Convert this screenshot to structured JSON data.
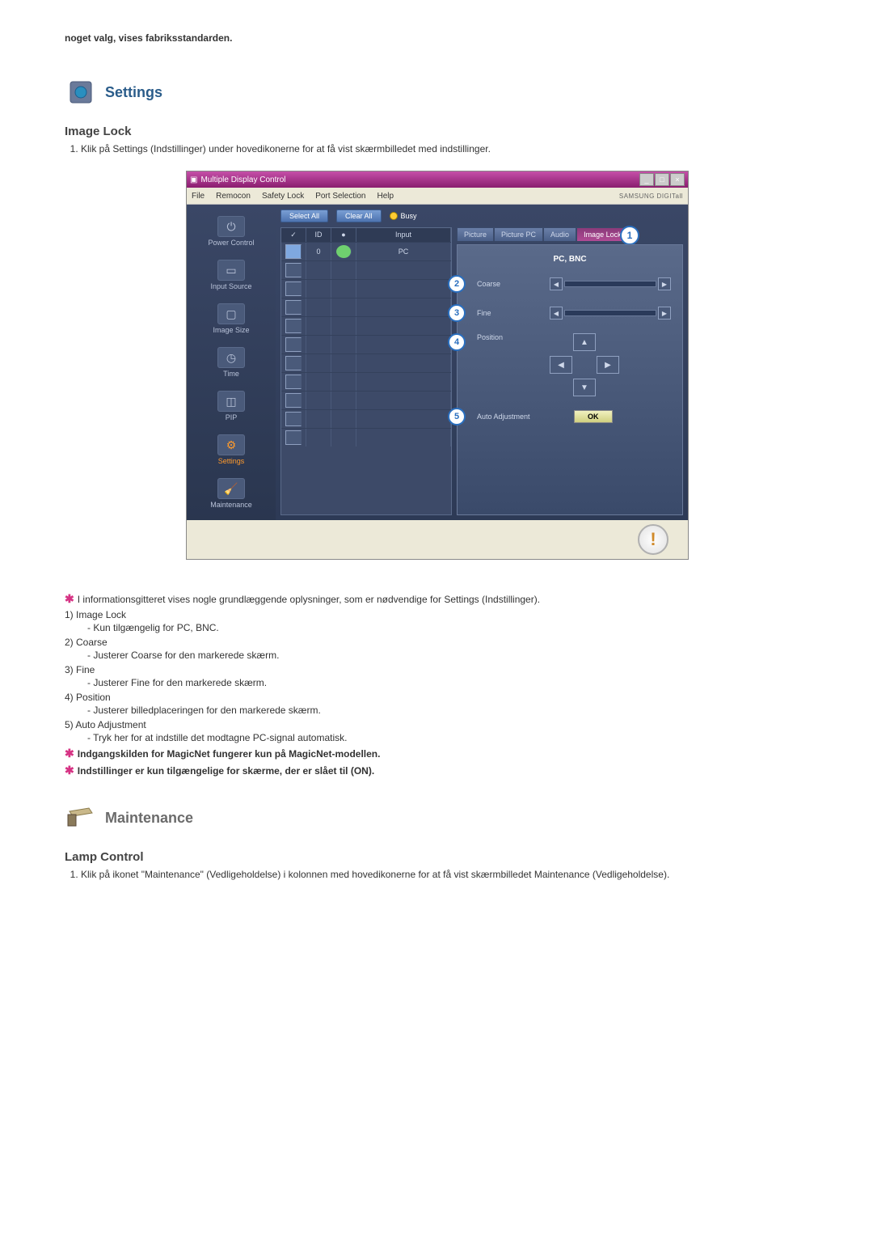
{
  "topNote": "noget valg, vises fabriksstandarden.",
  "sections": {
    "settings": {
      "title": "Settings",
      "sub": "Image Lock",
      "step1": "Klik på Settings (Indstillinger) under hovedikonerne for at få vist skærmbilledet med indstillinger."
    },
    "maintenance": {
      "title": "Maintenance",
      "sub": "Lamp Control",
      "step1": "Klik på ikonet \"Maintenance\" (Vedligeholdelse) i kolonnen med hovedikonerne for at få vist skærmbilledet Maintenance (Vedligeholdelse)."
    }
  },
  "app": {
    "title": "Multiple Display Control",
    "menus": [
      "File",
      "Remocon",
      "Safety Lock",
      "Port Selection",
      "Help"
    ],
    "brand": "SAMSUNG DIGITall",
    "sidebar": [
      {
        "label": "Power Control"
      },
      {
        "label": "Input Source"
      },
      {
        "label": "Image Size"
      },
      {
        "label": "Time"
      },
      {
        "label": "PIP"
      },
      {
        "label": "Settings",
        "highlight": true
      },
      {
        "label": "Maintenance"
      }
    ],
    "toolbar": {
      "selectAll": "Select All",
      "clearAll": "Clear All",
      "busy": "Busy"
    },
    "gridHeaders": {
      "chk": "✓",
      "id": "ID",
      "status": "●",
      "input": "Input"
    },
    "gridRows": [
      {
        "checked": true,
        "id": "0",
        "status": "green",
        "input": "PC"
      }
    ],
    "emptyRows": 10,
    "tabs": [
      "Picture",
      "Picture PC",
      "Audio",
      "Image Lock"
    ],
    "activeTab": 3,
    "panel": {
      "title": "PC, BNC",
      "coarse": "Coarse",
      "fine": "Fine",
      "position": "Position",
      "auto": "Auto Adjustment",
      "ok": "OK"
    }
  },
  "descriptions": {
    "intro": "I informationsgitteret vises nogle grundlæggende oplysninger, som er nødvendige for Settings (Indstillinger).",
    "items": [
      {
        "num": "1)",
        "title": "Image Lock",
        "sub": "- Kun tilgængelig for PC, BNC."
      },
      {
        "num": "2)",
        "title": "Coarse",
        "sub": "- Justerer Coarse for den markerede skærm."
      },
      {
        "num": "3)",
        "title": "Fine",
        "sub": "- Justerer Fine for den markerede skærm."
      },
      {
        "num": "4)",
        "title": "Position",
        "sub": "- Justerer billedplaceringen for den markerede skærm."
      },
      {
        "num": "5)",
        "title": "Auto Adjustment",
        "sub": "- Tryk her for at indstille det modtagne PC-signal automatisk."
      }
    ],
    "note1": "Indgangskilden for MagicNet fungerer kun på MagicNet-modellen.",
    "note2": "Indstillinger er kun tilgængelige for skærme, der er slået til (ON)."
  }
}
